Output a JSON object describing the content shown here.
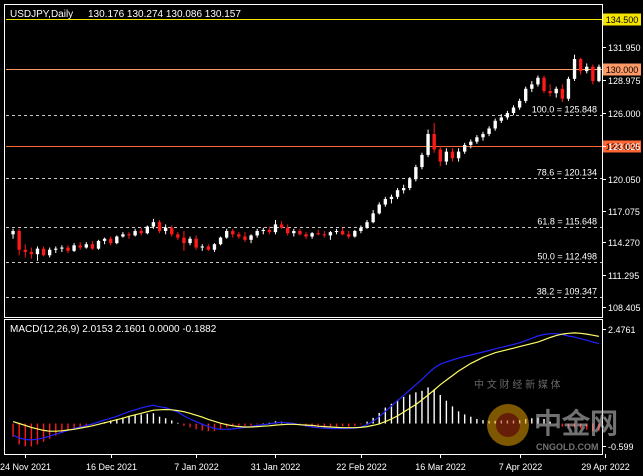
{
  "chart_data": {
    "type": "candlestick",
    "symbol_label": "USDJPY,Daily",
    "ohlc_label": "130.176 130.274 130.086 130.157",
    "price_axis": {
      "ylim": [
        107.5,
        135.8
      ],
      "tick_labels": [
        "131.950",
        "128.975",
        "126.000",
        "123.025",
        "120.050",
        "117.075",
        "114.270",
        "111.295",
        "108.405"
      ],
      "tick_values": [
        131.95,
        128.975,
        126.0,
        123.025,
        120.05,
        117.075,
        114.27,
        111.295,
        108.405
      ]
    },
    "horizontal_levels": [
      {
        "label": "134.500",
        "value": 134.5,
        "style": "solid",
        "color": "#f5e300",
        "tag": true
      },
      {
        "label": "130.000",
        "value": 130.0,
        "style": "solid",
        "color": "#ff9966",
        "tag": true
      },
      {
        "label": "123.000",
        "value": 123.0,
        "style": "solid",
        "color": "#ff6633",
        "tag": true
      }
    ],
    "fib_levels": [
      {
        "label": "100.0 = 125.848",
        "value": 125.848
      },
      {
        "label": "78.6 = 120.134",
        "value": 120.134
      },
      {
        "label": "61.8 = 115.648",
        "value": 115.648
      },
      {
        "label": "50.0 = 112.498",
        "value": 112.498
      },
      {
        "label": "38.2 = 109.347",
        "value": 109.347
      }
    ],
    "x_axis_labels": [
      "24 Nov 2021",
      "16 Dec 2021",
      "7 Jan 2022",
      "31 Jan 2022",
      "22 Feb 2022",
      "16 Mar 2022",
      "7 Apr 2022",
      "29 Apr 2022"
    ],
    "x_label_index": [
      2,
      16,
      30,
      43,
      57,
      70,
      83,
      97
    ],
    "candles": [
      [
        115.0,
        115.5,
        114.6,
        115.3
      ],
      [
        115.3,
        115.5,
        113.1,
        113.6
      ],
      [
        113.6,
        114.1,
        112.9,
        113.4
      ],
      [
        113.4,
        113.8,
        112.8,
        113.2
      ],
      [
        113.2,
        113.9,
        112.6,
        113.7
      ],
      [
        113.7,
        113.9,
        113.0,
        113.1
      ],
      [
        113.1,
        113.8,
        112.9,
        113.6
      ],
      [
        113.6,
        113.9,
        113.3,
        113.7
      ],
      [
        113.7,
        114.0,
        113.4,
        113.8
      ],
      [
        113.8,
        114.0,
        113.3,
        113.5
      ],
      [
        113.5,
        114.2,
        113.4,
        114.0
      ],
      [
        114.0,
        114.3,
        113.6,
        113.8
      ],
      [
        113.8,
        114.3,
        113.7,
        114.1
      ],
      [
        114.1,
        114.4,
        113.6,
        113.7
      ],
      [
        113.7,
        114.5,
        113.6,
        114.4
      ],
      [
        114.4,
        114.7,
        114.1,
        114.6
      ],
      [
        114.6,
        114.8,
        114.0,
        114.2
      ],
      [
        114.2,
        114.9,
        114.1,
        114.8
      ],
      [
        114.8,
        115.2,
        114.7,
        115.0
      ],
      [
        115.0,
        115.2,
        114.6,
        114.9
      ],
      [
        114.9,
        115.5,
        114.8,
        115.3
      ],
      [
        115.3,
        115.6,
        114.9,
        115.1
      ],
      [
        115.1,
        115.8,
        115.0,
        115.7
      ],
      [
        115.7,
        116.4,
        115.5,
        116.1
      ],
      [
        116.1,
        116.3,
        115.1,
        115.3
      ],
      [
        115.3,
        115.9,
        115.0,
        115.6
      ],
      [
        115.6,
        115.8,
        114.8,
        115.0
      ],
      [
        115.0,
        115.2,
        114.5,
        114.7
      ],
      [
        114.7,
        115.3,
        113.5,
        114.2
      ],
      [
        114.2,
        114.8,
        114.0,
        114.6
      ],
      [
        114.6,
        114.9,
        113.6,
        113.8
      ],
      [
        113.8,
        114.1,
        113.5,
        113.9
      ],
      [
        113.9,
        114.1,
        113.5,
        113.6
      ],
      [
        113.6,
        114.2,
        113.4,
        114.1
      ],
      [
        114.1,
        114.8,
        114.0,
        114.7
      ],
      [
        114.7,
        115.5,
        114.6,
        115.3
      ],
      [
        115.3,
        115.5,
        114.7,
        115.0
      ],
      [
        115.0,
        115.2,
        114.6,
        114.8
      ],
      [
        114.8,
        115.2,
        114.3,
        114.5
      ],
      [
        114.5,
        115.0,
        114.2,
        114.9
      ],
      [
        114.9,
        115.5,
        114.7,
        115.3
      ],
      [
        115.3,
        115.6,
        115.0,
        115.4
      ],
      [
        115.4,
        115.7,
        115.0,
        115.2
      ],
      [
        115.2,
        116.3,
        115.0,
        115.9
      ],
      [
        115.9,
        116.2,
        115.5,
        115.6
      ],
      [
        115.6,
        115.9,
        114.9,
        115.1
      ],
      [
        115.1,
        115.5,
        114.8,
        115.3
      ],
      [
        115.3,
        115.5,
        114.9,
        115.0
      ],
      [
        115.0,
        115.2,
        114.6,
        114.8
      ],
      [
        114.8,
        115.2,
        114.6,
        115.1
      ],
      [
        115.1,
        115.4,
        114.9,
        115.0
      ],
      [
        115.0,
        115.3,
        114.7,
        114.9
      ],
      [
        114.9,
        115.3,
        114.5,
        115.2
      ],
      [
        115.2,
        115.5,
        115.0,
        115.3
      ],
      [
        115.3,
        115.6,
        114.9,
        115.0
      ],
      [
        115.0,
        115.3,
        114.6,
        114.8
      ],
      [
        114.8,
        115.4,
        114.7,
        115.3
      ],
      [
        115.3,
        115.8,
        115.1,
        115.6
      ],
      [
        115.6,
        116.3,
        115.5,
        116.1
      ],
      [
        116.1,
        117.2,
        116.0,
        116.9
      ],
      [
        116.9,
        117.9,
        116.8,
        117.7
      ],
      [
        117.7,
        118.4,
        117.5,
        118.2
      ],
      [
        118.2,
        118.6,
        117.8,
        118.4
      ],
      [
        118.4,
        119.2,
        118.2,
        119.0
      ],
      [
        119.0,
        119.5,
        118.7,
        119.2
      ],
      [
        119.2,
        120.2,
        119.0,
        120.0
      ],
      [
        120.0,
        121.3,
        119.8,
        121.1
      ],
      [
        121.1,
        122.4,
        120.9,
        122.2
      ],
      [
        122.2,
        124.5,
        122.0,
        124.1
      ],
      [
        124.1,
        125.1,
        122.4,
        122.7
      ],
      [
        122.7,
        123.0,
        121.2,
        121.6
      ],
      [
        121.6,
        122.8,
        121.3,
        122.5
      ],
      [
        122.5,
        122.8,
        121.6,
        121.9
      ],
      [
        121.9,
        122.8,
        121.6,
        122.5
      ],
      [
        122.5,
        123.3,
        122.3,
        123.1
      ],
      [
        123.1,
        123.6,
        122.8,
        123.4
      ],
      [
        123.4,
        124.0,
        123.2,
        123.8
      ],
      [
        123.8,
        124.3,
        123.5,
        124.1
      ],
      [
        124.1,
        124.8,
        123.9,
        124.6
      ],
      [
        124.6,
        125.5,
        124.4,
        125.3
      ],
      [
        125.3,
        125.9,
        125.1,
        125.6
      ],
      [
        125.6,
        126.2,
        125.4,
        126.0
      ],
      [
        126.0,
        126.7,
        125.8,
        126.5
      ],
      [
        126.5,
        127.3,
        126.3,
        127.1
      ],
      [
        127.1,
        128.4,
        126.9,
        128.2
      ],
      [
        128.2,
        128.9,
        127.9,
        128.6
      ],
      [
        128.6,
        129.4,
        128.4,
        129.2
      ],
      [
        129.2,
        129.4,
        127.8,
        128.0
      ],
      [
        128.0,
        128.6,
        127.5,
        127.8
      ],
      [
        127.8,
        128.4,
        127.4,
        128.2
      ],
      [
        128.2,
        128.6,
        127.0,
        127.3
      ],
      [
        127.3,
        129.3,
        127.1,
        129.1
      ],
      [
        129.1,
        131.3,
        128.9,
        130.9
      ],
      [
        130.9,
        131.0,
        129.5,
        129.8
      ],
      [
        129.8,
        130.5,
        129.6,
        130.2
      ],
      [
        130.2,
        130.4,
        128.6,
        128.9
      ],
      [
        128.9,
        130.4,
        128.8,
        130.2
      ]
    ],
    "macd": {
      "label": "MACD(12,26,9) 2.0153 2.1601 0.0000 -0.1882",
      "tick_labels": [
        "2.4761",
        "-0.599"
      ],
      "tick_values": [
        2.4761,
        -0.599
      ],
      "ylim": [
        -0.8,
        2.72
      ],
      "histogram": [
        -0.35,
        -0.55,
        -0.6,
        -0.6,
        -0.55,
        -0.48,
        -0.4,
        -0.32,
        -0.25,
        -0.18,
        -0.13,
        -0.1,
        -0.07,
        -0.04,
        0.0,
        0.04,
        0.08,
        0.12,
        0.16,
        0.2,
        0.22,
        0.24,
        0.26,
        0.27,
        0.18,
        0.14,
        0.08,
        0.02,
        -0.06,
        -0.1,
        -0.15,
        -0.18,
        -0.2,
        -0.2,
        -0.16,
        -0.1,
        -0.07,
        -0.06,
        -0.06,
        -0.05,
        -0.02,
        0.01,
        0.02,
        0.06,
        0.05,
        0.01,
        -0.02,
        -0.05,
        -0.08,
        -0.09,
        -0.1,
        -0.1,
        -0.1,
        -0.08,
        -0.07,
        -0.08,
        -0.06,
        -0.02,
        0.05,
        0.15,
        0.28,
        0.42,
        0.52,
        0.62,
        0.7,
        0.76,
        0.82,
        0.86,
        0.95,
        0.9,
        0.75,
        0.6,
        0.45,
        0.32,
        0.24,
        0.18,
        0.12,
        0.09,
        0.07,
        0.07,
        0.08,
        0.08,
        0.08,
        0.09,
        0.12,
        0.14,
        0.15,
        0.12,
        0.05,
        -0.02,
        -0.08,
        -0.1,
        -0.1,
        -0.12,
        -0.16,
        -0.2,
        -0.19
      ],
      "macd_line": [
        -0.3,
        -0.38,
        -0.42,
        -0.43,
        -0.41,
        -0.38,
        -0.33,
        -0.28,
        -0.23,
        -0.18,
        -0.13,
        -0.09,
        -0.05,
        -0.01,
        0.04,
        0.09,
        0.14,
        0.19,
        0.25,
        0.31,
        0.36,
        0.41,
        0.45,
        0.48,
        0.44,
        0.42,
        0.36,
        0.3,
        0.2,
        0.12,
        0.05,
        -0.02,
        -0.08,
        -0.13,
        -0.15,
        -0.15,
        -0.14,
        -0.12,
        -0.1,
        -0.08,
        -0.05,
        -0.03,
        -0.01,
        0.02,
        0.03,
        0.02,
        0.0,
        -0.03,
        -0.06,
        -0.09,
        -0.11,
        -0.12,
        -0.13,
        -0.13,
        -0.13,
        -0.13,
        -0.12,
        -0.09,
        -0.03,
        0.06,
        0.18,
        0.32,
        0.46,
        0.6,
        0.74,
        0.88,
        1.02,
        1.16,
        1.32,
        1.46,
        1.56,
        1.62,
        1.67,
        1.72,
        1.76,
        1.8,
        1.84,
        1.88,
        1.92,
        1.96,
        2.0,
        2.04,
        2.08,
        2.12,
        2.18,
        2.24,
        2.3,
        2.34,
        2.36,
        2.36,
        2.34,
        2.3,
        2.27,
        2.23,
        2.19,
        2.14,
        2.1
      ],
      "signal_line": [
        0.05,
        0.0,
        -0.05,
        -0.1,
        -0.14,
        -0.18,
        -0.2,
        -0.2,
        -0.19,
        -0.17,
        -0.15,
        -0.12,
        -0.09,
        -0.06,
        -0.02,
        0.02,
        0.06,
        0.1,
        0.14,
        0.19,
        0.23,
        0.27,
        0.31,
        0.35,
        0.36,
        0.37,
        0.36,
        0.34,
        0.31,
        0.27,
        0.22,
        0.17,
        0.11,
        0.06,
        0.01,
        -0.03,
        -0.06,
        -0.08,
        -0.09,
        -0.09,
        -0.08,
        -0.07,
        -0.06,
        -0.04,
        -0.03,
        -0.02,
        -0.02,
        -0.03,
        -0.04,
        -0.05,
        -0.07,
        -0.08,
        -0.09,
        -0.1,
        -0.11,
        -0.11,
        -0.11,
        -0.1,
        -0.08,
        -0.05,
        -0.01,
        0.05,
        0.12,
        0.2,
        0.3,
        0.4,
        0.5,
        0.62,
        0.75,
        0.88,
        1.02,
        1.14,
        1.26,
        1.38,
        1.48,
        1.58,
        1.66,
        1.74,
        1.8,
        1.86,
        1.9,
        1.94,
        1.98,
        2.02,
        2.06,
        2.1,
        2.14,
        2.2,
        2.26,
        2.31,
        2.35,
        2.37,
        2.38,
        2.37,
        2.35,
        2.32,
        2.29
      ]
    },
    "colors": {
      "up": "#ffffff",
      "down": "#ff1a1a",
      "grid": "#c8c8c8",
      "text": "#ffffff",
      "macd_line": "#2323ff",
      "signal_line": "#ffff66",
      "hist_up": "#ffffff",
      "hist_down": "#ff1a1a"
    }
  },
  "watermark": {
    "brand": "中金网",
    "domain": "CNGOLD.COM",
    "slogan": "中 文 财 经 新 媒 体"
  }
}
